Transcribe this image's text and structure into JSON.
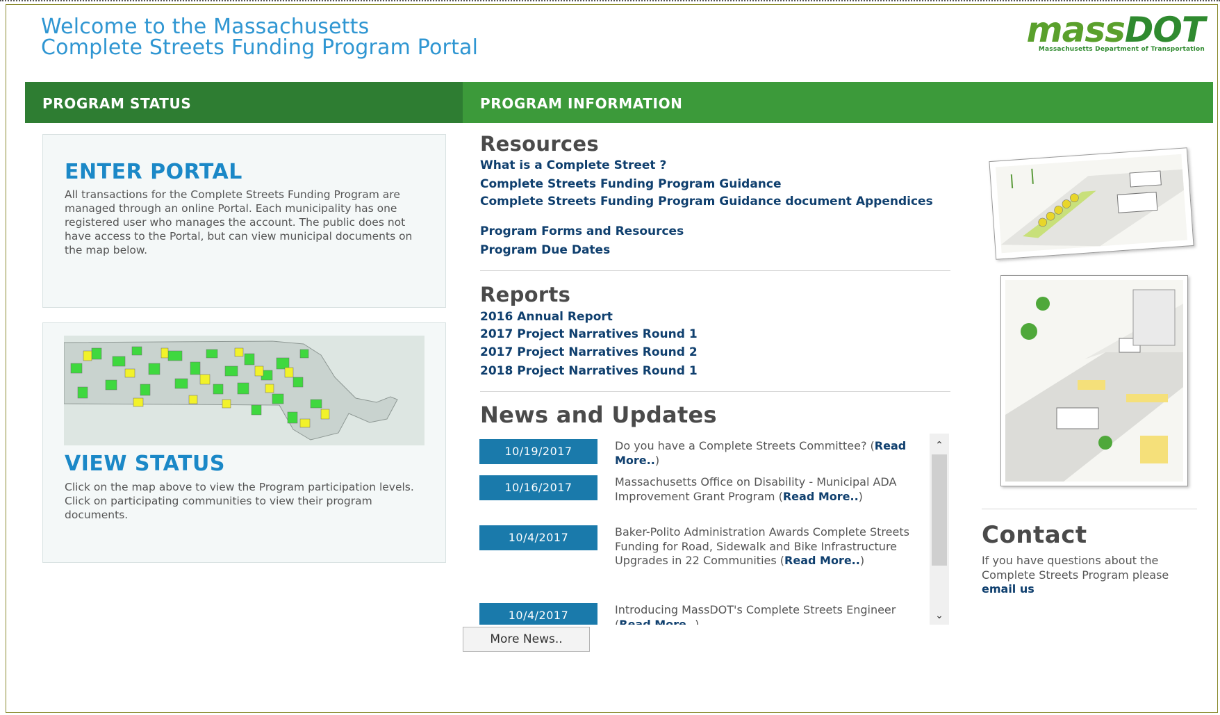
{
  "header": {
    "welcome_line1": "Welcome to the Massachusetts",
    "welcome_line2": "Complete Streets Funding Program Portal",
    "logo_mass": "mass",
    "logo_dot": "DOT",
    "logo_subtitle": "Massachusetts Department of Transportation"
  },
  "bars": {
    "status_title": "PROGRAM STATUS",
    "info_title": "PROGRAM INFORMATION"
  },
  "enter_portal": {
    "title": "ENTER PORTAL",
    "text": "All transactions for the Complete Streets Funding Program are managed through an online Portal. Each municipality has one registered user who manages the account. The public does not have access to the Portal, but can view municipal documents on the map below."
  },
  "view_status": {
    "title": "VIEW STATUS",
    "text": "Click on the map above to view the Program participation levels. Click on participating communities to view their program documents."
  },
  "resources": {
    "heading": "Resources",
    "links": [
      "What is a Complete Street ?",
      "Complete Streets Funding Program Guidance",
      "Complete Streets Funding Program Guidance document Appendices",
      "Program Forms and Resources",
      "Program Due Dates"
    ]
  },
  "reports": {
    "heading": "Reports",
    "links": [
      "2016 Annual Report",
      "2017 Project Narratives Round 1",
      "2017 Project Narratives Round 2",
      "2018 Project Narratives Round 1"
    ]
  },
  "news": {
    "heading": "News and Updates",
    "items": [
      {
        "date": "10/19/2017",
        "text": "Do you have a Complete Streets Committee? (",
        "link": "Read More..",
        "tail": ")"
      },
      {
        "date": "10/16/2017",
        "text": "Massachusetts Office on Disability - Municipal ADA Improvement Grant Program (",
        "link": "Read More..",
        "tail": ")"
      },
      {
        "date": "10/4/2017",
        "text": "Baker-Polito Administration Awards Complete Streets Funding for Road, Sidewalk and Bike Infrastructure Upgrades in 22 Communities (",
        "link": "Read More..",
        "tail": ")"
      },
      {
        "date": "10/4/2017",
        "text": "Introducing MassDOT's Complete Streets Engineer (",
        "link": "Read More..",
        "tail": ")"
      }
    ],
    "more_button": "More News.."
  },
  "contact": {
    "heading": "Contact",
    "text": "If you have questions about the Complete Streets Program please ",
    "link": "email us"
  },
  "colors": {
    "accent_blue": "#2f96d2",
    "link_navy": "#0f3f6e",
    "bar_green_dark": "#2e7d32",
    "bar_green": "#3c9a3a",
    "date_blue": "#1a7aab"
  },
  "icons": {
    "scroll_up": "chevron-up-icon",
    "scroll_down": "chevron-down-icon"
  }
}
